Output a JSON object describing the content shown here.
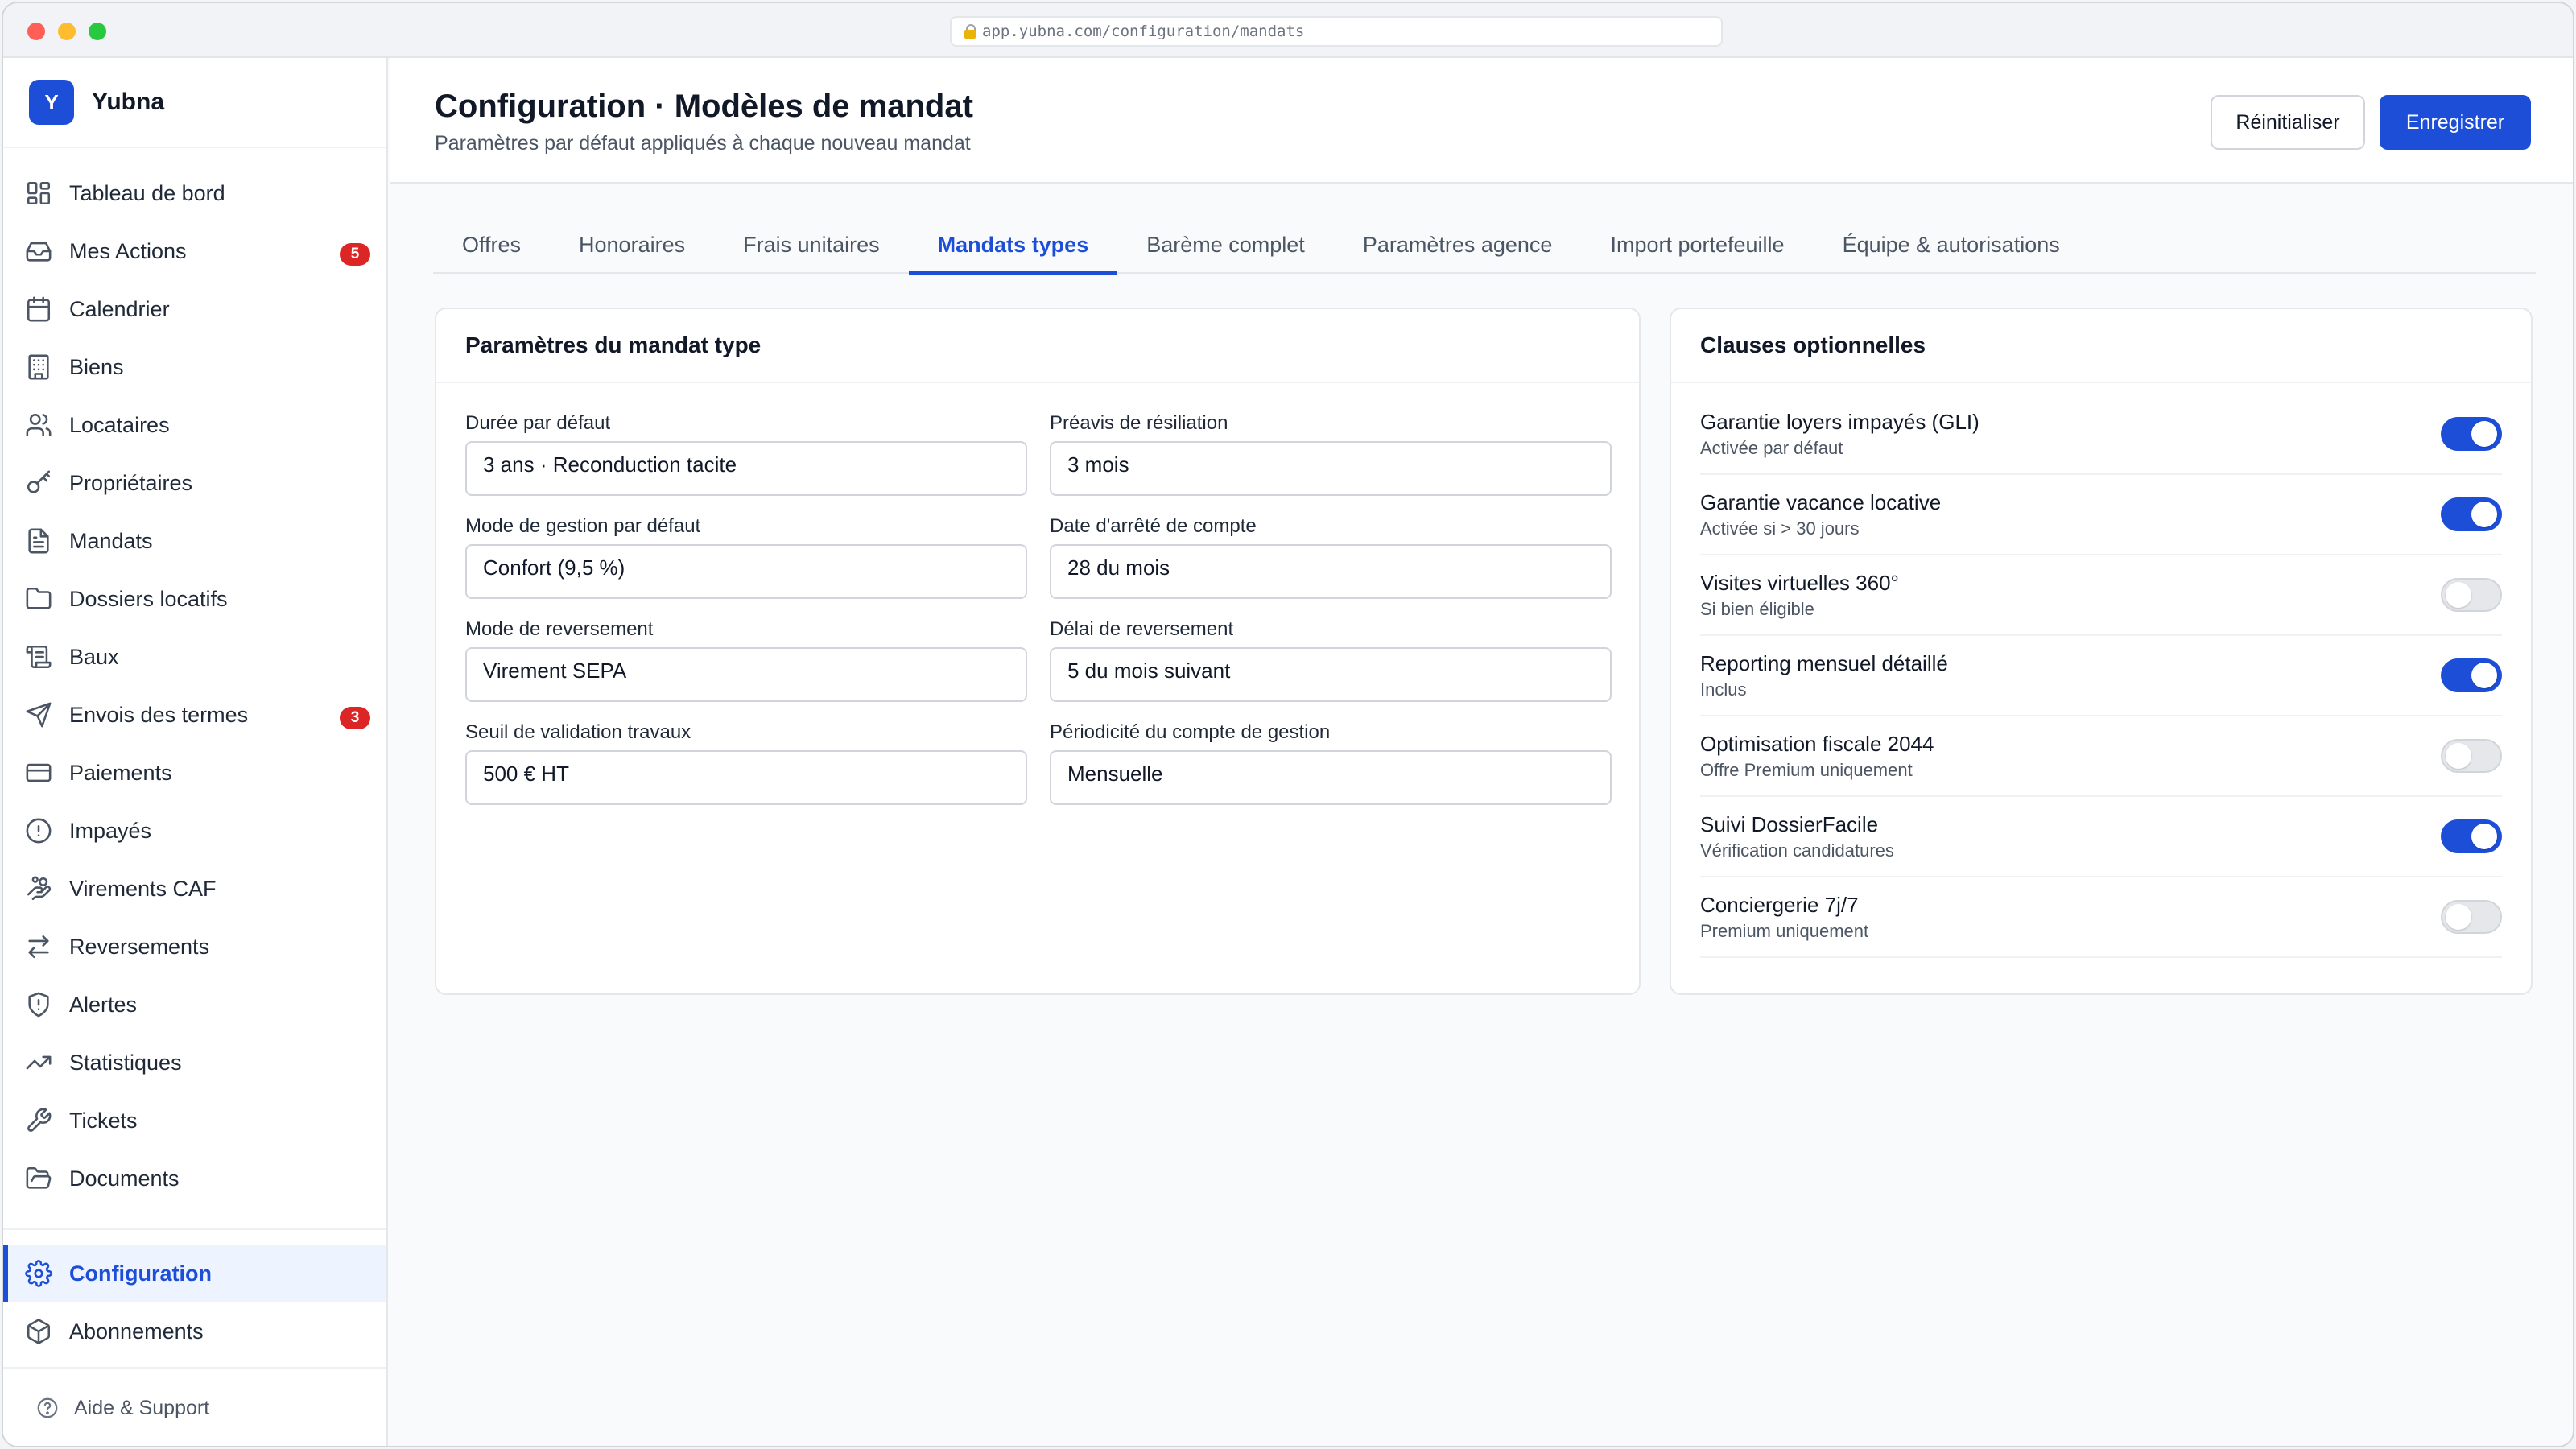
{
  "browser": {
    "url": "app.yubna.com/configuration/mandats"
  },
  "brand": {
    "logo_letter": "Y",
    "name": "Yubna"
  },
  "sidebar": {
    "items": [
      {
        "label": "Tableau de bord",
        "icon": "dashboard-icon"
      },
      {
        "label": "Mes Actions",
        "icon": "inbox-icon",
        "badge": "5"
      },
      {
        "label": "Calendrier",
        "icon": "calendar-icon"
      },
      {
        "label": "Biens",
        "icon": "building-icon"
      },
      {
        "label": "Locataires",
        "icon": "users-icon"
      },
      {
        "label": "Propriétaires",
        "icon": "key-icon"
      },
      {
        "label": "Mandats",
        "icon": "document-icon"
      },
      {
        "label": "Dossiers locatifs",
        "icon": "folder-icon"
      },
      {
        "label": "Baux",
        "icon": "scroll-icon"
      },
      {
        "label": "Envois des termes",
        "icon": "send-icon",
        "badge": "3"
      },
      {
        "label": "Paiements",
        "icon": "credit-card-icon"
      },
      {
        "label": "Impayés",
        "icon": "alert-circle-icon"
      },
      {
        "label": "Virements CAF",
        "icon": "hand-coins-icon"
      },
      {
        "label": "Reversements",
        "icon": "arrows-exchange-icon"
      },
      {
        "label": "Alertes",
        "icon": "shield-alert-icon"
      },
      {
        "label": "Statistiques",
        "icon": "trending-up-icon"
      },
      {
        "label": "Tickets",
        "icon": "wrench-icon"
      },
      {
        "label": "Documents",
        "icon": "folder-open-icon"
      }
    ],
    "bottom_items": [
      {
        "label": "Configuration",
        "icon": "gear-icon",
        "active": true
      },
      {
        "label": "Abonnements",
        "icon": "package-icon"
      }
    ],
    "help_label": "Aide & Support"
  },
  "header": {
    "title": "Configuration · Modèles de mandat",
    "subtitle": "Paramètres par défaut appliqués à chaque nouveau mandat",
    "reset_label": "Réinitialiser",
    "save_label": "Enregistrer"
  },
  "tabs": [
    {
      "label": "Offres"
    },
    {
      "label": "Honoraires"
    },
    {
      "label": "Frais unitaires"
    },
    {
      "label": "Mandats types",
      "active": true
    },
    {
      "label": "Barème complet"
    },
    {
      "label": "Paramètres agence"
    },
    {
      "label": "Import portefeuille"
    },
    {
      "label": "Équipe & autorisations"
    }
  ],
  "params": {
    "title": "Paramètres du mandat type",
    "fields": [
      {
        "label": "Durée par défaut",
        "value": "3 ans · Reconduction tacite"
      },
      {
        "label": "Préavis de résiliation",
        "value": "3 mois"
      },
      {
        "label": "Mode de gestion par défaut",
        "value": "Confort (9,5 %)"
      },
      {
        "label": "Date d'arrêté de compte",
        "value": "28 du mois"
      },
      {
        "label": "Mode de reversement",
        "value": "Virement SEPA"
      },
      {
        "label": "Délai de reversement",
        "value": "5 du mois suivant"
      },
      {
        "label": "Seuil de validation travaux",
        "value": "500 € HT"
      },
      {
        "label": "Périodicité du compte de gestion",
        "value": "Mensuelle"
      }
    ]
  },
  "clauses": {
    "title": "Clauses optionnelles",
    "items": [
      {
        "name": "Garantie loyers impayés (GLI)",
        "desc": "Activée par défaut",
        "on": true
      },
      {
        "name": "Garantie vacance locative",
        "desc": "Activée si > 30 jours",
        "on": true
      },
      {
        "name": "Visites virtuelles 360°",
        "desc": "Si bien éligible",
        "on": false
      },
      {
        "name": "Reporting mensuel détaillé",
        "desc": "Inclus",
        "on": true
      },
      {
        "name": "Optimisation fiscale 2044",
        "desc": "Offre Premium uniquement",
        "on": false
      },
      {
        "name": "Suivi DossierFacile",
        "desc": "Vérification candidatures",
        "on": true
      },
      {
        "name": "Conciergerie 7j/7",
        "desc": "Premium uniquement",
        "on": false
      }
    ]
  },
  "colors": {
    "accent": "#1d4ed8",
    "badge": "#dc2626"
  }
}
